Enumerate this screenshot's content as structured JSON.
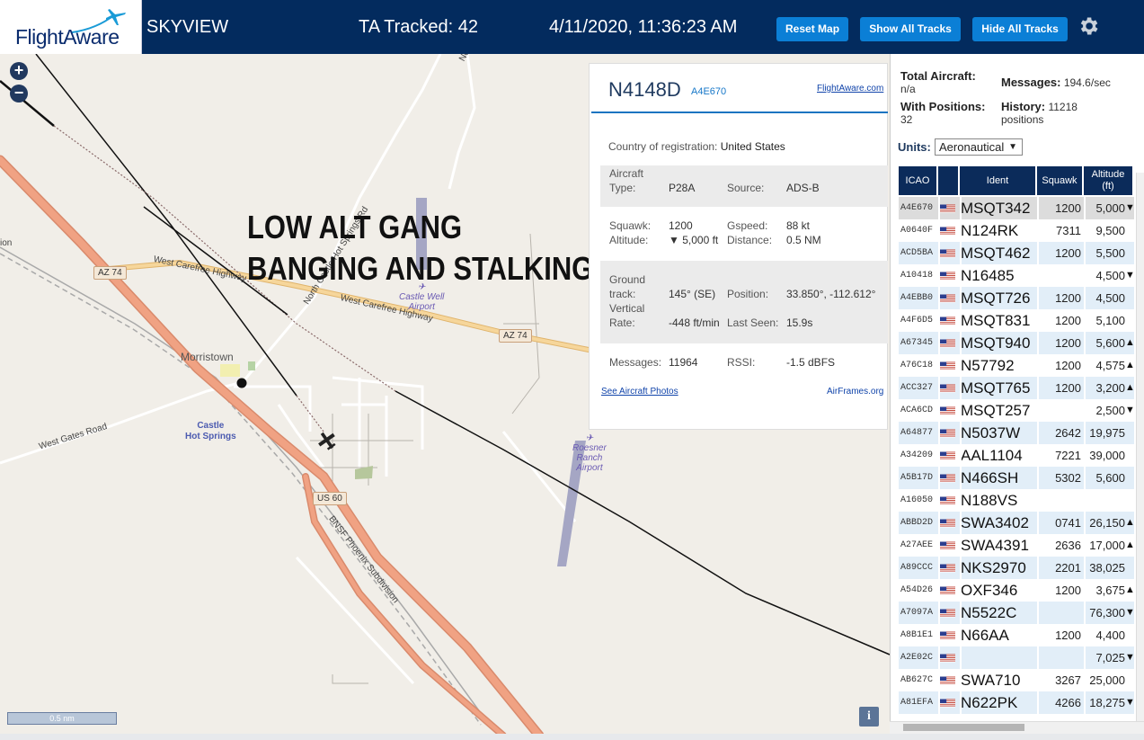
{
  "header": {
    "logo_text": "FlightAware",
    "app_title": "SKYVIEW",
    "ta_tracked": "TA Tracked: 42",
    "datetime": "4/11/2020, 11:36:23 AM",
    "buttons": {
      "reset_map": "Reset Map",
      "show_all_tracks": "Show All Tracks",
      "hide_all_tracks": "Hide All Tracks"
    },
    "settings_icon": "gear-icon"
  },
  "map": {
    "zoom_in": "+",
    "zoom_out": "−",
    "overlay_caption_line1": "LOW ALT GANG",
    "overlay_caption_line2": "BANGING AND STALKING",
    "town": "Morristown",
    "hot_springs_line1": "Castle",
    "hot_springs_line2": "Hot Springs",
    "airport1_line1": "Castle Well",
    "airport1_line2": "Airport",
    "airport2_line1": "Roesner",
    "airport2_line2": "Ranch",
    "airport2_line3": "Airport",
    "roads": {
      "carefree_1": "West Carefree Highway",
      "carefree_2": "West Carefree Highway",
      "north_castle": "North Castle",
      "north_castle_hot_springs": "North Castle Hot Springs Rd",
      "west_gates": "West Gates Road",
      "bnsf": "BNSF Phoenix Subdivision",
      "edge_label": "ion"
    },
    "shields": {
      "az74_a": "AZ 74",
      "az74_b": "AZ 74",
      "us60": "US 60"
    },
    "scale": "0.5 nm",
    "info": "i",
    "colors": {
      "background": "#f1eee8",
      "highway": "#f0a283",
      "track": "#111111"
    }
  },
  "aircraft_panel": {
    "callsign": "N4148D",
    "icao": "A4E670",
    "flightaware_link": "FlightAware.com",
    "country_label": "Country of registration:",
    "country": "United States",
    "aircraft_type_label_1": "Aircraft",
    "aircraft_type_label_2": "Type:",
    "aircraft_type": "P28A",
    "source_label": "Source:",
    "source": "ADS-B",
    "squawk_label": "Squawk:",
    "squawk": "1200",
    "gspeed_label": "Gspeed:",
    "gspeed": "88 kt",
    "altitude_label": "Altitude:",
    "altitude": "▼ 5,000 ft",
    "distance_label": "Distance:",
    "distance": "0.5 NM",
    "ground_track_label_1": "Ground",
    "ground_track_label_2": "track:",
    "ground_track": "145° (SE)",
    "position_label": "Position:",
    "position": "33.850°, -112.612°",
    "vertical_rate_label_1": "Vertical",
    "vertical_rate_label_2": "Rate:",
    "vertical_rate": "-448 ft/min",
    "last_seen_label": "Last Seen:",
    "last_seen": "15.9s",
    "messages_label": "Messages:",
    "messages": "11964",
    "rssi_label": "RSSI:",
    "rssi": "-1.5 dBFS",
    "photos_link": "See Aircraft Photos",
    "airframes_link": "AirFrames.org"
  },
  "sidebar": {
    "total_aircraft_label": "Total Aircraft:",
    "total_aircraft": "n/a",
    "messages_label": "Messages:",
    "messages": "194.6/sec",
    "with_positions_label": "With Positions:",
    "with_positions": "32",
    "history_label": "History:",
    "history_value": "11218",
    "history_unit": "positions",
    "units_label": "Units:",
    "units_selected": "Aeronautical",
    "table_headers": {
      "icao": "ICAO",
      "ident": "Ident",
      "squawk": "Squawk",
      "altitude_1": "Altitude",
      "altitude_2": "(ft)"
    },
    "rows": [
      {
        "icao": "A4E670",
        "ident": "MSQT342",
        "squawk": "1200",
        "alt": "5,000",
        "trend": "▼"
      },
      {
        "icao": "A0640F",
        "ident": "N124RK",
        "squawk": "7311",
        "alt": "9,500",
        "trend": ""
      },
      {
        "icao": "ACD5BA",
        "ident": "MSQT462",
        "squawk": "1200",
        "alt": "5,500",
        "trend": ""
      },
      {
        "icao": "A10418",
        "ident": "N16485",
        "squawk": "",
        "alt": "4,500",
        "trend": "▼"
      },
      {
        "icao": "A4EBB0",
        "ident": "MSQT726",
        "squawk": "1200",
        "alt": "4,500",
        "trend": ""
      },
      {
        "icao": "A4F6D5",
        "ident": "MSQT831",
        "squawk": "1200",
        "alt": "5,100",
        "trend": ""
      },
      {
        "icao": "A67345",
        "ident": "MSQT940",
        "squawk": "1200",
        "alt": "5,600",
        "trend": "▲"
      },
      {
        "icao": "A76C18",
        "ident": "N57792",
        "squawk": "1200",
        "alt": "4,575",
        "trend": "▲"
      },
      {
        "icao": "ACC327",
        "ident": "MSQT765",
        "squawk": "1200",
        "alt": "3,200",
        "trend": "▲"
      },
      {
        "icao": "ACA6CD",
        "ident": "MSQT257",
        "squawk": "",
        "alt": "2,500",
        "trend": "▼"
      },
      {
        "icao": "A64877",
        "ident": "N5037W",
        "squawk": "2642",
        "alt": "19,975",
        "trend": ""
      },
      {
        "icao": "A34209",
        "ident": "AAL1104",
        "squawk": "7221",
        "alt": "39,000",
        "trend": ""
      },
      {
        "icao": "A5B17D",
        "ident": "N466SH",
        "squawk": "5302",
        "alt": "5,600",
        "trend": ""
      },
      {
        "icao": "A16050",
        "ident": "N188VS",
        "squawk": "",
        "alt": "",
        "trend": ""
      },
      {
        "icao": "ABBD2D",
        "ident": "SWA3402",
        "squawk": "0741",
        "alt": "26,150",
        "trend": "▲"
      },
      {
        "icao": "A27AEE",
        "ident": "SWA4391",
        "squawk": "2636",
        "alt": "17,000",
        "trend": "▲"
      },
      {
        "icao": "A89CCC",
        "ident": "NKS2970",
        "squawk": "2201",
        "alt": "38,025",
        "trend": ""
      },
      {
        "icao": "A54D26",
        "ident": "OXF346",
        "squawk": "1200",
        "alt": "3,675",
        "trend": "▲"
      },
      {
        "icao": "A7097A",
        "ident": "N5522C",
        "squawk": "",
        "alt": "76,300",
        "trend": "▼"
      },
      {
        "icao": "A8B1E1",
        "ident": "N66AA",
        "squawk": "1200",
        "alt": "4,400",
        "trend": ""
      },
      {
        "icao": "A2E02C",
        "ident": "",
        "squawk": "",
        "alt": "7,025",
        "trend": "▼"
      },
      {
        "icao": "AB627C",
        "ident": "SWA710",
        "squawk": "3267",
        "alt": "25,000",
        "trend": ""
      },
      {
        "icao": "A81EFA",
        "ident": "N622PK",
        "squawk": "4266",
        "alt": "18,275",
        "trend": "▼"
      }
    ]
  }
}
